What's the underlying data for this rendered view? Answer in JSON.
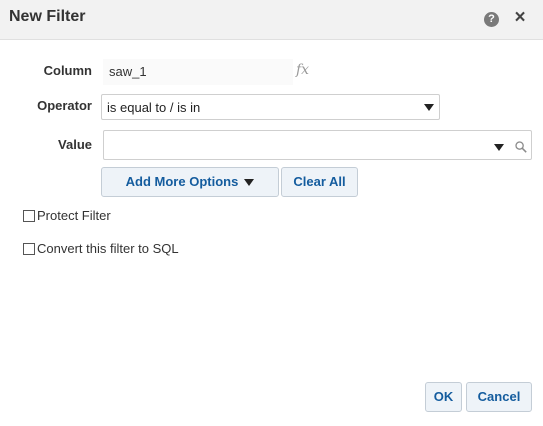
{
  "dialog": {
    "title": "New Filter",
    "help_icon": "help-icon",
    "close_icon": "close-icon",
    "help_glyph": "?",
    "close_glyph": "×"
  },
  "form": {
    "column_label": "Column",
    "column_value": "saw_1",
    "fx_label": "fx",
    "operator_label": "Operator",
    "operator_value": "is equal to / is in",
    "value_label": "Value",
    "value_value": ""
  },
  "actions": {
    "add_more_options": "Add More Options",
    "clear_all": "Clear All"
  },
  "options": {
    "protect_filter": "Protect Filter",
    "protect_filter_checked": false,
    "convert_to_sql": "Convert this filter to SQL",
    "convert_to_sql_checked": false
  },
  "footer": {
    "ok": "OK",
    "cancel": "Cancel"
  },
  "colors": {
    "button_text": "#145c9e",
    "button_bg": "#eef3f8",
    "titlebar_bg": "#f2f2f2"
  }
}
